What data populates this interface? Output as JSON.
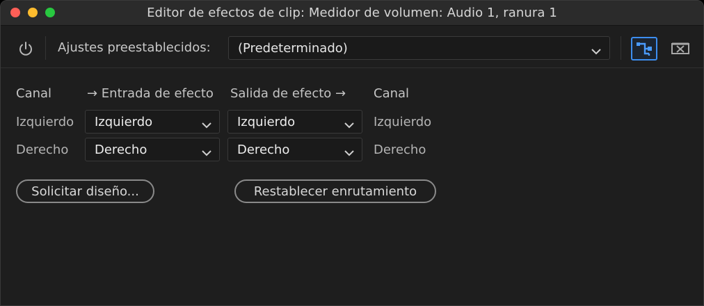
{
  "window": {
    "title": "Editor de efectos de clip: Medidor de volumen: Audio 1, ranura 1"
  },
  "toolbar": {
    "power_icon": "power-icon",
    "presets_label": "Ajustes preestablecidos:",
    "presets_value": "(Predeterminado)",
    "routing_icon": "routing-icon",
    "close_icon": "close-panel-icon",
    "accent_color": "#3d8ef0"
  },
  "routing": {
    "headers": {
      "input_channel": "Canal",
      "effect_input": "→ Entrada de efecto",
      "effect_output": "Salida de efecto →",
      "output_channel": "Canal"
    },
    "rows": [
      {
        "input_label": "Izquierdo",
        "effect_input": "Izquierdo",
        "effect_output": "Izquierdo",
        "output_label": "Izquierdo"
      },
      {
        "input_label": "Derecho",
        "effect_input": "Derecho",
        "effect_output": "Derecho",
        "output_label": "Derecho"
      }
    ]
  },
  "actions": {
    "request_layout": "Solicitar diseño...",
    "reset_routing": "Restablecer enrutamiento"
  }
}
